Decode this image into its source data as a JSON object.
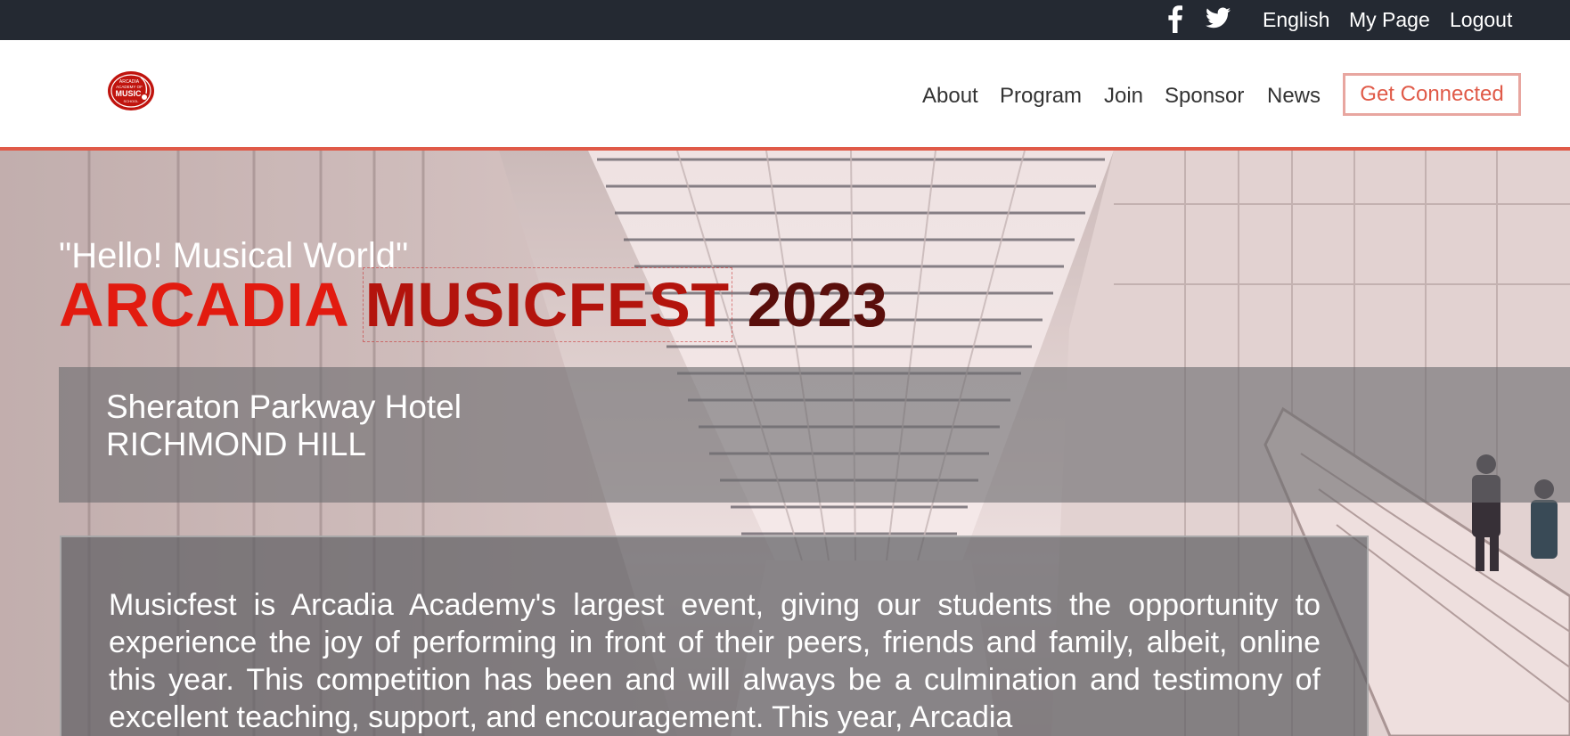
{
  "topbar": {
    "social": [
      {
        "icon": "facebook-icon"
      },
      {
        "icon": "twitter-icon"
      }
    ],
    "language": "English",
    "my_page": "My Page",
    "logout": "Logout"
  },
  "header": {
    "logo_text": [
      "ARCADIA",
      "ACADEMY OF",
      "MUSIC",
      "SCHOOL"
    ],
    "nav": {
      "about": "About",
      "program": "Program",
      "join": "Join",
      "sponsor": "Sponsor",
      "news": "News"
    },
    "cta_label": "Get Connected"
  },
  "hero": {
    "tagline": "\"Hello! Musical World\"",
    "title": {
      "word1": "ARCADIA",
      "word2": "MUSICFEST",
      "word3": "2023"
    },
    "venue": {
      "line1": "Sheraton Parkway Hotel",
      "line2": "RICHMOND HILL"
    },
    "description": "Musicfest is Arcadia Academy's largest event, giving our students the opportunity to experience the joy of performing in front of their peers, friends and family, albeit, online this year. This competition has been and will always be a culmination and testimony of excellent teaching, support, and encouragement. This year, Arcadia"
  },
  "colors": {
    "topbar_bg": "#242932",
    "accent": "#e05a48",
    "title_red": "#e21b10",
    "title_dark_red": "#5a0f0c"
  }
}
